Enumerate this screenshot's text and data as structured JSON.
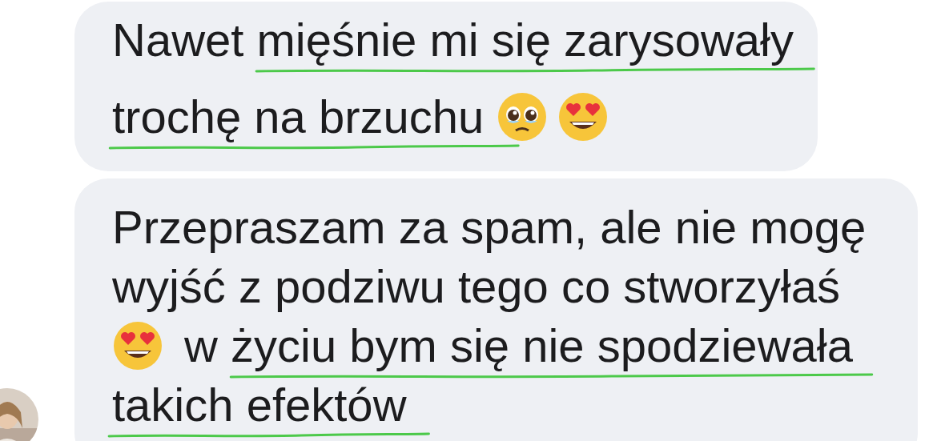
{
  "messages": [
    {
      "avatar": false,
      "lines": [
        [
          {
            "kind": "text",
            "text": "Nawet ",
            "underlined": false
          },
          {
            "kind": "text",
            "text": "mięśnie mi się zarysowały",
            "underlined": true
          }
        ],
        [
          {
            "kind": "text",
            "text": "trochę na brzuchu ",
            "underlined": true
          },
          {
            "kind": "emoji-teary"
          },
          {
            "kind": "emoji-heart-eyes"
          }
        ]
      ]
    },
    {
      "avatar": true,
      "lines": [
        [
          {
            "kind": "text",
            "text": "Przepraszam za spam, ale nie mogę",
            "underlined": false
          }
        ],
        [
          {
            "kind": "text",
            "text": "wyjść z podziwu tego co stworzyłaś",
            "underlined": false
          }
        ],
        [
          {
            "kind": "emoji-heart-eyes"
          },
          {
            "kind": "text",
            "text": "w ",
            "underlined": false
          },
          {
            "kind": "text",
            "text": "życiu bym się nie spodziewała",
            "underlined": true
          }
        ],
        [
          {
            "kind": "text",
            "text": "takich efektów",
            "underlined": true
          }
        ]
      ]
    }
  ]
}
